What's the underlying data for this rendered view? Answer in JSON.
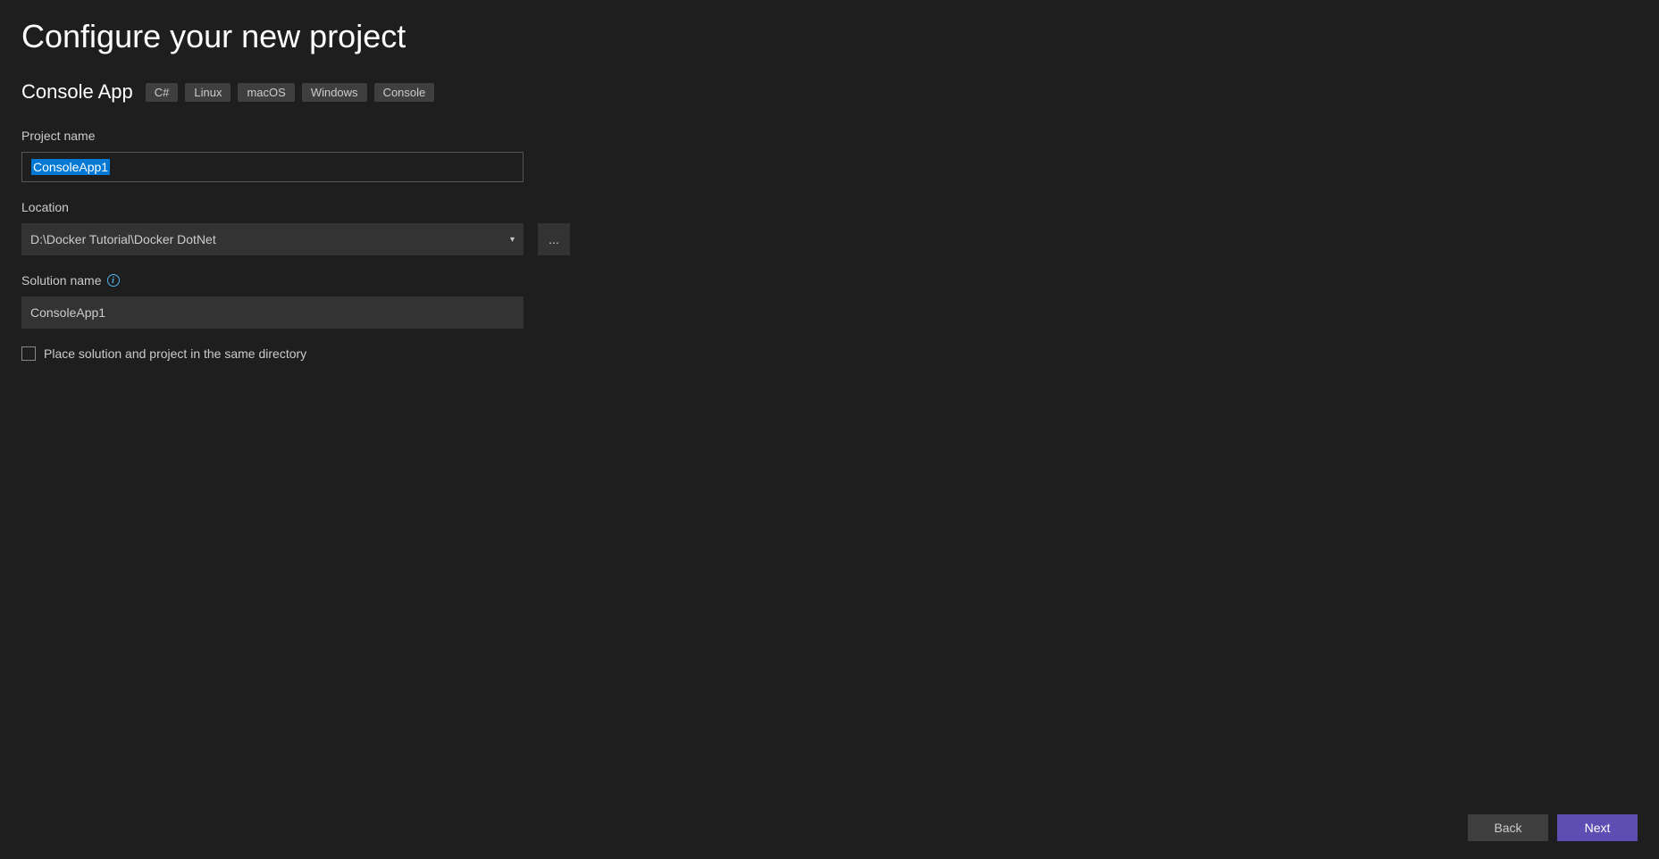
{
  "page": {
    "title": "Configure your new project"
  },
  "projectType": {
    "name": "Console App",
    "tags": [
      "C#",
      "Linux",
      "macOS",
      "Windows",
      "Console"
    ]
  },
  "fields": {
    "projectName": {
      "label": "Project name",
      "value": "ConsoleApp1"
    },
    "location": {
      "label": "Location",
      "value": "D:\\Docker Tutorial\\Docker DotNet",
      "browseLabel": "..."
    },
    "solutionName": {
      "label": "Solution name",
      "value": "ConsoleApp1"
    },
    "sameDirectory": {
      "label": "Place solution and project in the same directory",
      "checked": false
    }
  },
  "buttons": {
    "back": "Back",
    "next": "Next"
  }
}
